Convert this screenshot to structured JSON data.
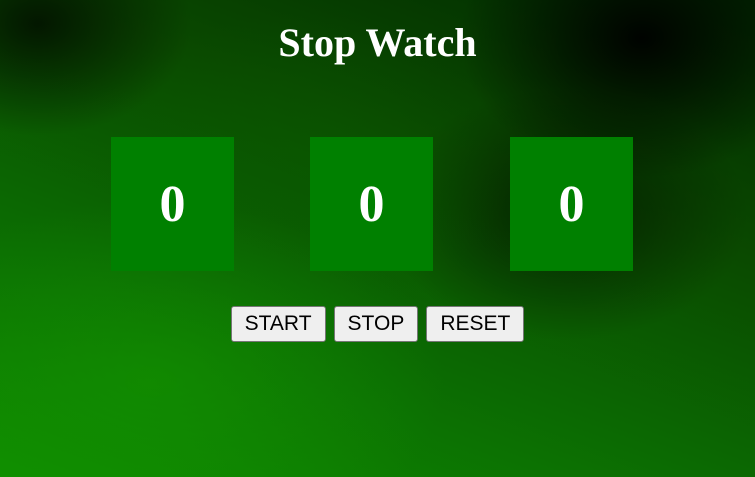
{
  "title": "Stop Watch",
  "display": {
    "hours": "0",
    "minutes": "0",
    "seconds": "0"
  },
  "controls": {
    "start_label": "START",
    "stop_label": "STOP",
    "reset_label": "RESET"
  },
  "colors": {
    "display_box": "#008000",
    "text": "#ffffff",
    "button_bg": "#efefef"
  }
}
